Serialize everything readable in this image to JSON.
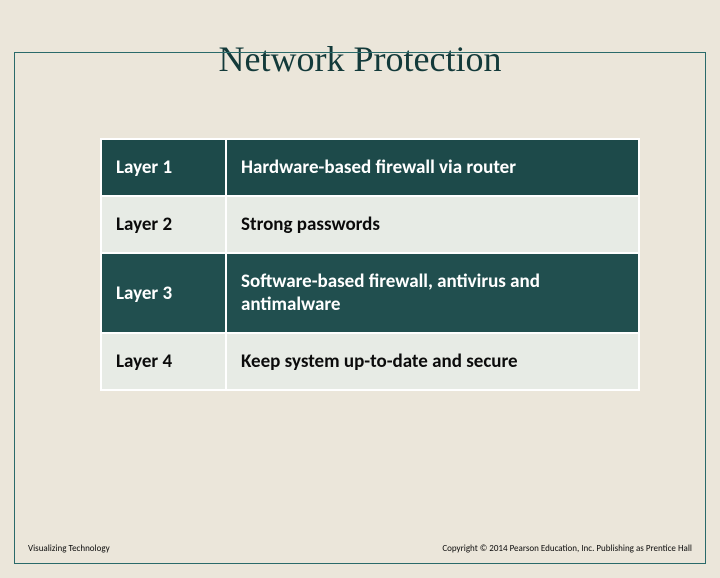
{
  "title": "Network Protection",
  "rows": [
    {
      "layer": "Layer 1",
      "desc": "Hardware-based firewall via router"
    },
    {
      "layer": "Layer 2",
      "desc": "Strong passwords"
    },
    {
      "layer": "Layer 3",
      "desc": "Software-based firewall, antivirus and antimalware"
    },
    {
      "layer": "Layer 4",
      "desc": "Keep system up-to-date and secure"
    }
  ],
  "footer": {
    "left": "Visualizing Technology",
    "right": "Copyright © 2014 Pearson Education, Inc. Publishing as Prentice Hall"
  }
}
